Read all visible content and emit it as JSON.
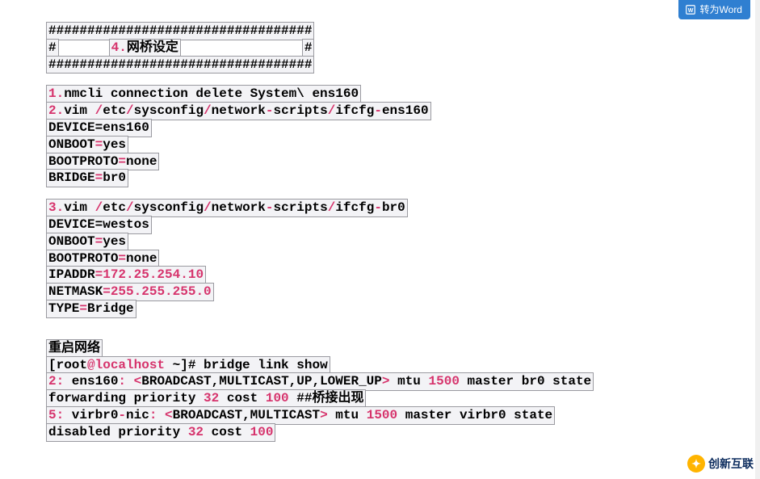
{
  "button": {
    "convert_word": "转为Word"
  },
  "header": {
    "hash_line": "##################################",
    "title_left": "#",
    "title_num": "4.",
    "title_text": "网桥设定",
    "title_right": "#"
  },
  "sec1": {
    "l1_num": "1.",
    "l1_cmd": "nmcli connection delete System\\ ens160",
    "l2_num": "2.",
    "l2_a": "vim ",
    "l2_path": "/etc/sysconfig/network-scripts/ifcfg-ens160",
    "l3": "DEVICE=ens160",
    "l4_a": "ONBOOT",
    "l4_eq": "=",
    "l4_b": "yes",
    "l5_a": "BOOTPROTO",
    "l5_eq": "=",
    "l5_b": "none",
    "l6_a": "BRIDGE",
    "l6_eq": "=",
    "l6_b": "br0"
  },
  "sec2": {
    "l1_num": "3.",
    "l1_a": "vim ",
    "l1_path": "/etc/sysconfig/network-scripts/ifcfg-br0",
    "l2": "DEVICE=westos",
    "l3_a": "ONBOOT",
    "l3_eq": "=",
    "l3_b": "yes",
    "l4_a": "BOOTPROTO",
    "l4_eq": "=",
    "l4_b": "none",
    "l5_a": "IPADDR",
    "l5_eq": "=",
    "l5_b": "172.25.254.10",
    "l6_a": "NETMASK",
    "l6_eq": "=",
    "l6_b": "255.255.255.0",
    "l7_a": "TYPE",
    "l7_eq": "=",
    "l7_b": "Bridge"
  },
  "sec3": {
    "title": "重启网络",
    "p1_a": "[root",
    "p1_b": "@localhost",
    "p1_c": " ~",
    "p1_d": "]# bridge link show",
    "r2_a": "2:",
    "r2_b": " ens160",
    "r2_c": ": ",
    "r2_d": "<",
    "r2_e": "BROADCAST,MULTICAST,UP,LOWER_UP",
    "r2_f": ">",
    "r2_g": " mtu ",
    "r2_h": "1500",
    "r2_i": " master br0 state ",
    "r3_a": "forwarding priority ",
    "r3_b": "32",
    "r3_c": " cost ",
    "r3_d": "100",
    "r3_e": "  ##桥接出现",
    "r4_a": "5:",
    "r4_b": " virbr0",
    "r4_c": "-",
    "r4_d": "nic",
    "r4_e": ": ",
    "r4_f": "<",
    "r4_g": "BROADCAST,MULTICAST",
    "r4_h": ">",
    "r4_i": " mtu ",
    "r4_j": "1500",
    "r4_k": " master virbr0 state ",
    "r5_a": "disabled priority ",
    "r5_b": "32",
    "r5_c": " cost ",
    "r5_d": "100"
  },
  "logo": {
    "text": "创新互联"
  }
}
